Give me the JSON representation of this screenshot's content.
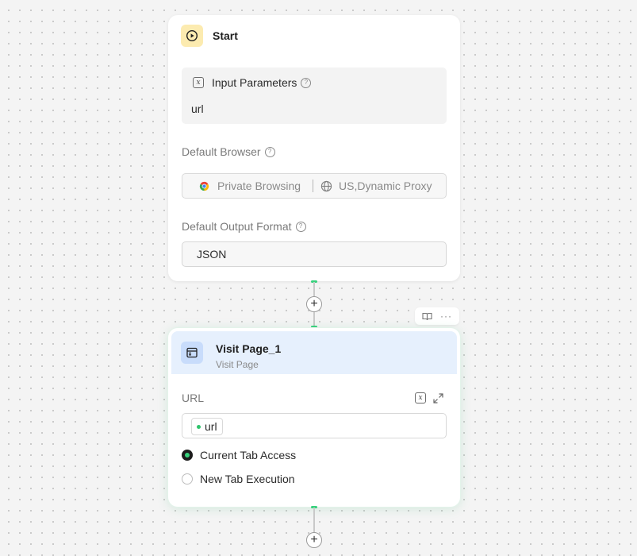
{
  "start_node": {
    "title": "Start",
    "icon": "play-circle-icon",
    "input_parameters": {
      "label": "Input Parameters",
      "value": "url"
    },
    "default_browser": {
      "label": "Default Browser",
      "browser_mode": "Private Browsing",
      "proxy": "US,Dynamic Proxy"
    },
    "default_output_format": {
      "label": "Default Output Format",
      "value": "JSON"
    }
  },
  "visit_node": {
    "title": "Visit Page_1",
    "subtitle": "Visit Page",
    "icon": "browser-window-icon",
    "url_field": {
      "label": "URL",
      "chip_value": "url"
    },
    "tab_options": [
      {
        "label": "Current Tab Access",
        "selected": true
      },
      {
        "label": "New Tab Execution",
        "selected": false
      }
    ]
  },
  "colors": {
    "connector_accent": "#39d27e",
    "start_icon_bg": "#fcebb0",
    "visit_header_bg": "#e6f0fd"
  }
}
